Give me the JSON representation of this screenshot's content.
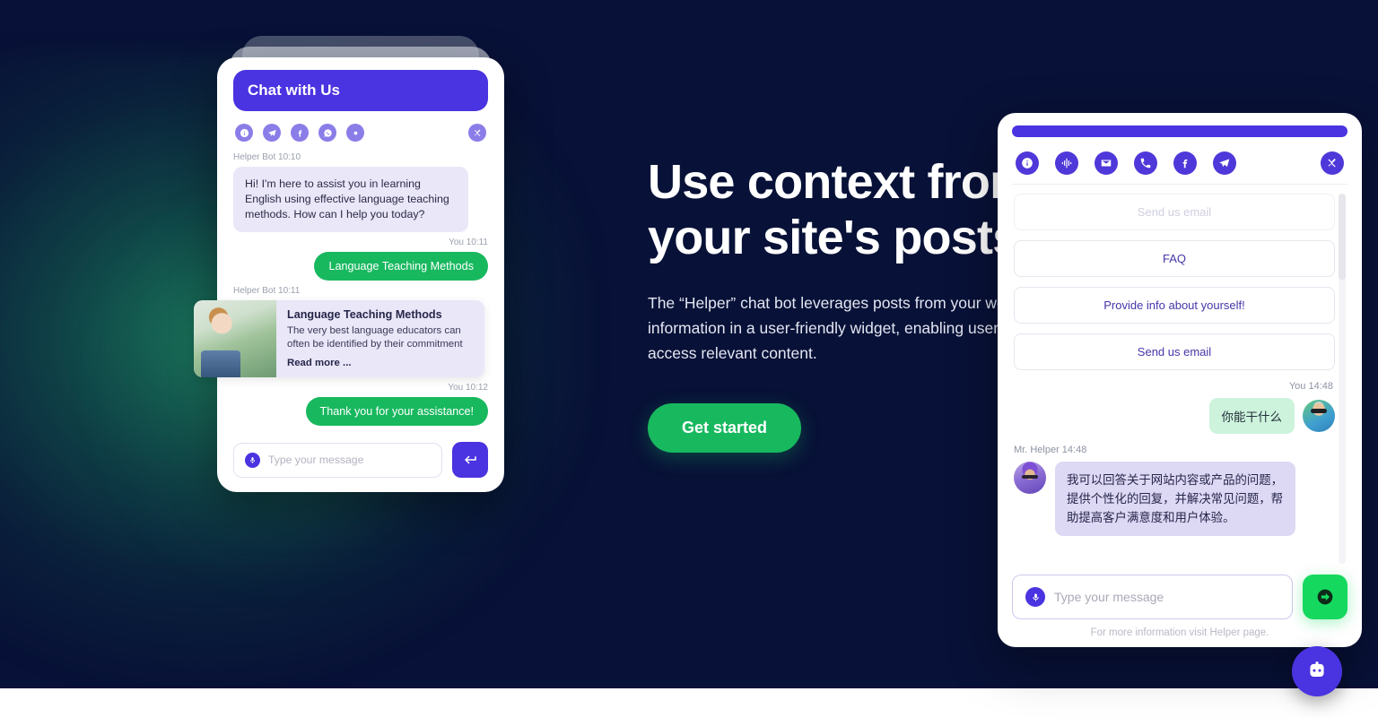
{
  "hero": {
    "headline": "Use context from\nyour site's posts",
    "subcopy": "The “Helper” chat bot leverages posts from your website and presents the information in a user-friendly widget, enabling users to conveniently read and access relevant content.",
    "cta_label": "Get started",
    "background_color": "#081137",
    "accent_green": "#18b85f",
    "accent_purple": "#4a33e0"
  },
  "left_widget": {
    "header_title": "Chat with Us",
    "icons": [
      {
        "name": "info-icon",
        "label": "Info"
      },
      {
        "name": "telegram-icon",
        "label": "Telegram"
      },
      {
        "name": "facebook-icon",
        "label": "Facebook"
      },
      {
        "name": "whatsapp-icon",
        "label": "WhatsApp"
      },
      {
        "name": "viber-icon",
        "label": "Viber"
      }
    ],
    "close_label": "Close",
    "messages": [
      {
        "meta": "Helper Bot 10:10",
        "text": "Hi! I'm here to assist you in learning English using effective language teaching methods. How can I help you today?"
      },
      {
        "meta": "You 10:11",
        "text": "Language Teaching Methods"
      },
      {
        "meta": "Helper Bot 10:11"
      },
      {
        "meta": "You 10:12",
        "text": "Thank you for your assistance!"
      }
    ],
    "post_card": {
      "title": "Language Teaching Methods",
      "excerpt": "The very best language educators can often be identified by their commitment",
      "read_more": "Read more ..."
    },
    "input_placeholder": "Type your message",
    "send_label": "Send"
  },
  "right_widget": {
    "icons": [
      {
        "name": "info-icon",
        "label": "Info"
      },
      {
        "name": "voice-icon",
        "label": "Voice"
      },
      {
        "name": "email-icon",
        "label": "Email"
      },
      {
        "name": "phone-icon",
        "label": "Phone"
      },
      {
        "name": "facebook-icon",
        "label": "Facebook"
      },
      {
        "name": "telegram-icon",
        "label": "Telegram"
      }
    ],
    "close_label": "Close",
    "quick_options": [
      {
        "label": "Send us email",
        "faded": true
      },
      {
        "label": "FAQ",
        "faded": false
      },
      {
        "label": "Provide info about yourself!",
        "faded": false
      },
      {
        "label": "Send us email",
        "faded": false
      }
    ],
    "messages": [
      {
        "meta": "You  14:48",
        "text": "你能干什么",
        "from": "user"
      },
      {
        "meta": "Mr. Helper 14:48",
        "text": "我可以回答关于网站内容或产品的问题，提供个性化的回复，并解决常见问题，帮助提高客户满意度和用户体验。",
        "from": "bot"
      }
    ],
    "input_placeholder": "Type your message",
    "send_label": "Send",
    "footer_note": "For more information visit Helper page."
  },
  "launcher": {
    "name": "chat-bot-launcher",
    "label": "Open chat"
  }
}
